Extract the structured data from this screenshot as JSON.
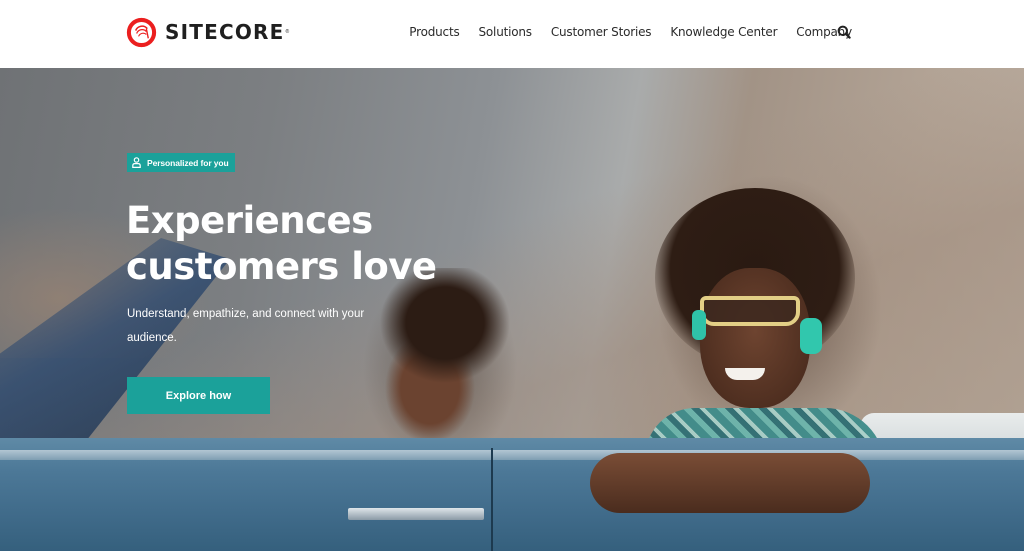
{
  "header": {
    "logo": {
      "icon": "sitecore-logo-icon",
      "text": "SITECORE",
      "registered": "®",
      "brand_color": "#eb1f1f"
    },
    "nav": [
      {
        "label": "Products"
      },
      {
        "label": "Solutions"
      },
      {
        "label": "Customer Stories"
      },
      {
        "label": "Knowledge Center"
      },
      {
        "label": "Company"
      }
    ],
    "search_icon": "search-icon"
  },
  "hero": {
    "badge": {
      "icon": "user-icon",
      "label": "Personalized for you"
    },
    "title_line1": "Experiences",
    "title_line2": "customers love",
    "subtitle": "Understand, empathize, and connect with your audience.",
    "cta_label": "Explore how",
    "accent_color": "#1ba19a",
    "image_description": "Two people smiling in a blue convertible car in front of desert mountains"
  }
}
